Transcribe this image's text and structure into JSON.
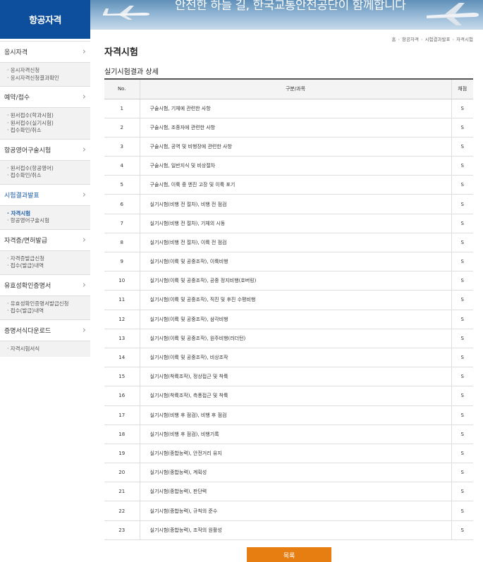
{
  "header": {
    "logo": "항공자격",
    "slogan": "안전한 하늘 길, 한국교통안전공단이 함께합니다"
  },
  "breadcrumb": [
    "홈",
    "항공자격",
    "시험결과발표",
    "자격시험"
  ],
  "sidebar": [
    {
      "label": "응시자격",
      "active": false,
      "subs": [
        {
          "label": "· 응시자격신청",
          "on": false
        },
        {
          "label": "· 응시자격신청결과확인",
          "on": false
        }
      ]
    },
    {
      "label": "예약/접수",
      "active": false,
      "subs": [
        {
          "label": "· 원서접수(학과시험)",
          "on": false
        },
        {
          "label": "· 원서접수(실기시험)",
          "on": false
        },
        {
          "label": "· 접수확인/취소",
          "on": false
        }
      ]
    },
    {
      "label": "항공영어구술시험",
      "active": false,
      "subs": [
        {
          "label": "· 원서접수(항공영어)",
          "on": false
        },
        {
          "label": "· 접수확인/취소",
          "on": false
        }
      ]
    },
    {
      "label": "시험결과발표",
      "active": true,
      "subs": [
        {
          "label": "· 자격시험",
          "on": true
        },
        {
          "label": "· 항공영어구술시험",
          "on": false
        }
      ]
    },
    {
      "label": "자격증/면허발급",
      "active": false,
      "subs": [
        {
          "label": "· 자격증발급신청",
          "on": false
        },
        {
          "label": "· 접수(발급)내역",
          "on": false
        }
      ]
    },
    {
      "label": "유효성확인증명서",
      "active": false,
      "subs": [
        {
          "label": "· 유효성확인증명서발급신청",
          "on": false
        },
        {
          "label": "· 접수(발급)내역",
          "on": false
        }
      ]
    },
    {
      "label": "증명서식다운로드",
      "active": false,
      "subs": [
        {
          "label": "· 자격시험서식",
          "on": false
        }
      ]
    }
  ],
  "page_title": "자격시험",
  "section_title": "실기시험결과 상세",
  "table": {
    "headers": [
      "No.",
      "구분/과목",
      "채점"
    ],
    "rows": [
      [
        "1",
        "구술시험, 기체에 관련한 사항",
        "S"
      ],
      [
        "2",
        "구술시험, 조종자에 관련한 사항",
        "S"
      ],
      [
        "3",
        "구술시험, 공역 및 비행장에 관련한 사항",
        "S"
      ],
      [
        "4",
        "구술시험, 일반지식 및 비상절차",
        "S"
      ],
      [
        "5",
        "구술시험, 이륙 중 엔진 고장 및 이륙 포기",
        "S"
      ],
      [
        "6",
        "실기시험(비행 전 절차), 비행 전 점검",
        "S"
      ],
      [
        "7",
        "실기시험(비행 전 절차), 기체의 시동",
        "S"
      ],
      [
        "8",
        "실기시험(비행 전 절차), 이륙 전 점검",
        "S"
      ],
      [
        "9",
        "실기시험(이륙 및 공중조작), 이륙비행",
        "S"
      ],
      [
        "10",
        "실기시험(이륙 및 공중조작), 공중 정지비행(호버링)",
        "S"
      ],
      [
        "11",
        "실기시험(이륙 및 공중조작), 직진 및 후진 수평비행",
        "S"
      ],
      [
        "12",
        "실기시험(이륙 및 공중조작), 삼각비행",
        "S"
      ],
      [
        "13",
        "실기시험(이륙 및 공중조작), 원주비행(러더턴)",
        "S"
      ],
      [
        "14",
        "실기시험(이륙 및 공중조작), 비상조작",
        "S"
      ],
      [
        "15",
        "실기시험(착륙조작), 정상접근 및 착륙",
        "S"
      ],
      [
        "16",
        "실기시험(착륙조작), 측풍접근 및 착륙",
        "S"
      ],
      [
        "17",
        "실기시험(비행 후 점검), 비행 후 점검",
        "S"
      ],
      [
        "18",
        "실기시험(비행 후 점검), 비행기록",
        "S"
      ],
      [
        "19",
        "실기시험(종합능력), 안전거리 유지",
        "S"
      ],
      [
        "20",
        "실기시험(종합능력), 계획성",
        "S"
      ],
      [
        "21",
        "실기시험(종합능력), 판단력",
        "S"
      ],
      [
        "22",
        "실기시험(종합능력), 규칙의 준수",
        "S"
      ],
      [
        "23",
        "실기시험(종합능력), 조작의 원활성",
        "S"
      ]
    ]
  },
  "list_button": "목록",
  "colors": {
    "brand_blue": "#0d4f9c",
    "active_blue": "#1a5aa8",
    "button_orange": "#e67e12"
  }
}
